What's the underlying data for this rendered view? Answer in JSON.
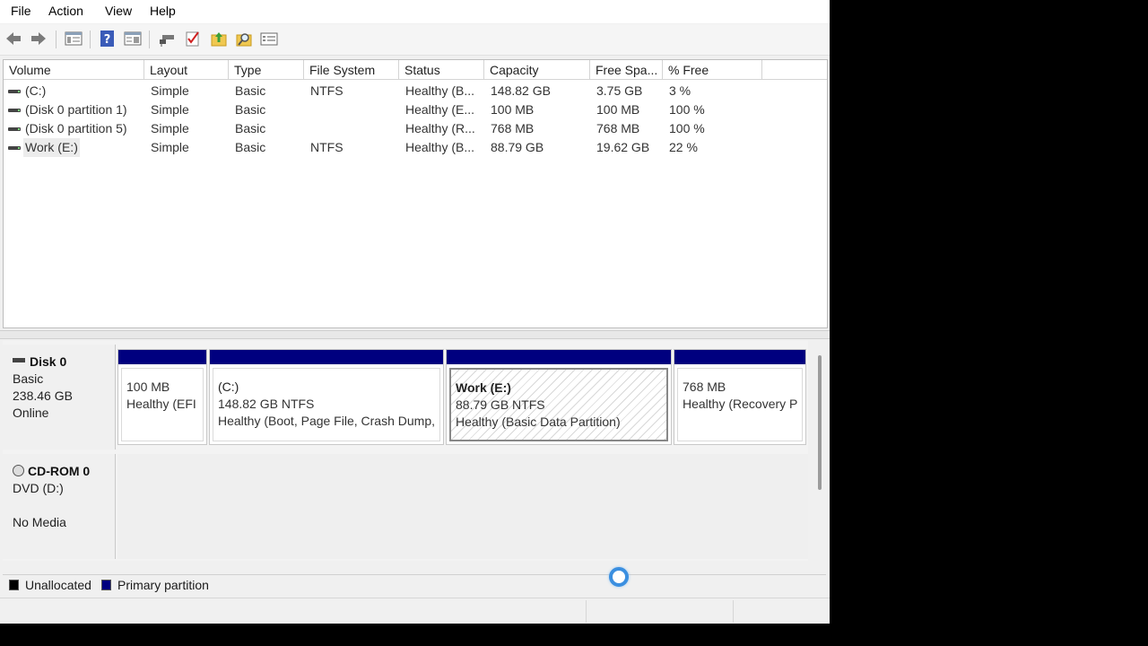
{
  "menu": {
    "file": "File",
    "action": "Action",
    "view": "View",
    "help": "Help"
  },
  "toolbar": {
    "icons": [
      "back-arrow-icon",
      "forward-arrow-icon",
      "console-tree-icon",
      "help-icon",
      "properties-pane-icon",
      "connect-icon",
      "check-icon",
      "folder-up-icon",
      "search-folder-icon",
      "settings-list-icon"
    ]
  },
  "volume_list": {
    "columns": [
      "Volume",
      "Layout",
      "Type",
      "File System",
      "Status",
      "Capacity",
      "Free Spa...",
      "% Free"
    ],
    "rows": [
      {
        "volume": " (C:)",
        "layout": "Simple",
        "type": "Basic",
        "fs": "NTFS",
        "status": "Healthy (B...",
        "capacity": "148.82 GB",
        "free": "3.75 GB",
        "pct": "3 %"
      },
      {
        "volume": "(Disk 0 partition 1)",
        "layout": "Simple",
        "type": "Basic",
        "fs": "",
        "status": "Healthy (E...",
        "capacity": "100 MB",
        "free": "100 MB",
        "pct": "100 %"
      },
      {
        "volume": "(Disk 0 partition 5)",
        "layout": "Simple",
        "type": "Basic",
        "fs": "",
        "status": "Healthy (R...",
        "capacity": "768 MB",
        "free": "768 MB",
        "pct": "100 %"
      },
      {
        "volume": "Work (E:)",
        "layout": "Simple",
        "type": "Basic",
        "fs": "NTFS",
        "status": "Healthy (B...",
        "capacity": "88.79 GB",
        "free": "19.62 GB",
        "pct": "22 %"
      }
    ]
  },
  "disks": {
    "disk0": {
      "name": "Disk 0",
      "type": "Basic",
      "size": "238.46 GB",
      "state": "Online"
    },
    "cdrom0": {
      "name": "CD-ROM 0",
      "type": "DVD (D:)",
      "state": "No Media"
    }
  },
  "partitions": [
    {
      "title": "",
      "size": "100 MB",
      "status": "Healthy (EFI"
    },
    {
      "title": " (C:)",
      "size": "148.82 GB NTFS",
      "status": "Healthy (Boot, Page File, Crash Dump,"
    },
    {
      "title": "Work  (E:)",
      "size": "88.79 GB NTFS",
      "status": "Healthy (Basic Data Partition)"
    },
    {
      "title": "",
      "size": "768 MB",
      "status": "Healthy (Recovery P"
    }
  ],
  "legend": {
    "unallocated": "Unallocated",
    "primary": "Primary partition",
    "unallocated_color": "#000000",
    "primary_color": "#00007f"
  }
}
